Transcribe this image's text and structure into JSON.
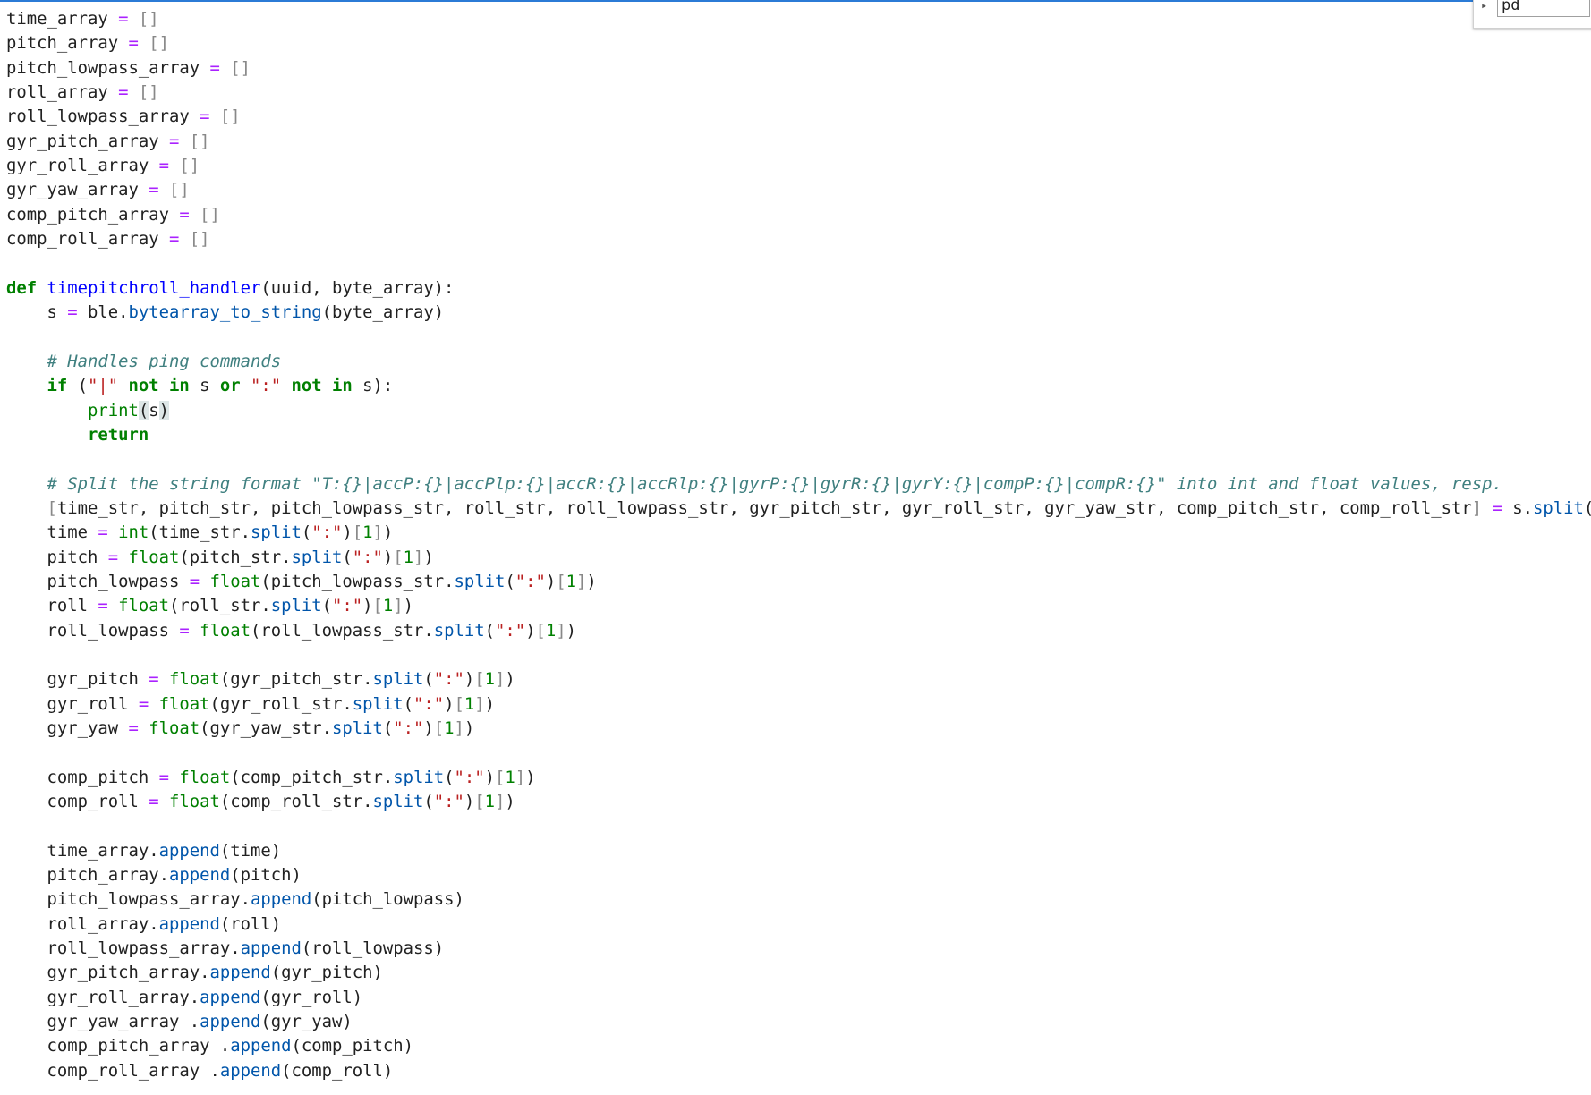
{
  "find_widget": {
    "value": "pd"
  },
  "code": {
    "arrays": [
      "time_array",
      "pitch_array",
      "pitch_lowpass_array",
      "roll_array",
      "roll_lowpass_array",
      "gyr_pitch_array",
      "gyr_roll_array",
      "gyr_yaw_array",
      "comp_pitch_array",
      "comp_roll_array"
    ],
    "func_name": "timepitchroll_handler",
    "params": "(uuid, byte_array):",
    "s_assign": "ble",
    "s_method": "bytearray_to_string",
    "s_arg": "(byte_array)",
    "comment_ping": "# Handles ping commands",
    "comment_split": "# Split the string format \"T:{}|accP:{}|accPlp:{}|accR:{}|accRlp:{}|gyrP:{}|gyrR:{}|gyrY:{}|compP:{}|compR:{}\" into int and float values, resp.",
    "unpack_list": "time_str, pitch_str, pitch_lowpass_str, roll_str, roll_lowpass_str, gyr_pitch_str, gyr_roll_str, gyr_yaw_str, comp_pitch_str, comp_roll_str",
    "parse_groups": [
      [
        {
          "var": "time",
          "cast": "int",
          "src": "time_str"
        },
        {
          "var": "pitch",
          "cast": "float",
          "src": "pitch_str"
        },
        {
          "var": "pitch_lowpass",
          "cast": "float",
          "src": "pitch_lowpass_str"
        },
        {
          "var": "roll",
          "cast": "float",
          "src": "roll_str"
        },
        {
          "var": "roll_lowpass",
          "cast": "float",
          "src": "roll_lowpass_str"
        }
      ],
      [
        {
          "var": "gyr_pitch",
          "cast": "float",
          "src": "gyr_pitch_str"
        },
        {
          "var": "gyr_roll",
          "cast": "float",
          "src": "gyr_roll_str"
        },
        {
          "var": "gyr_yaw",
          "cast": "float",
          "src": "gyr_yaw_str"
        }
      ],
      [
        {
          "var": "comp_pitch",
          "cast": "float",
          "src": "comp_pitch_str"
        },
        {
          "var": "comp_roll",
          "cast": "float",
          "src": "comp_roll_str"
        }
      ]
    ],
    "appends": [
      {
        "target": "time_array",
        "arg": "time"
      },
      {
        "target": "pitch_array",
        "arg": "pitch"
      },
      {
        "target": "pitch_lowpass_array",
        "arg": "pitch_lowpass"
      },
      {
        "target": "roll_array",
        "arg": "roll"
      },
      {
        "target": "roll_lowpass_array",
        "arg": "roll_lowpass"
      },
      {
        "target": "gyr_pitch_array",
        "arg": "gyr_pitch"
      },
      {
        "target": "gyr_roll_array",
        "arg": "gyr_roll"
      },
      {
        "target": "gyr_yaw_array ",
        "arg": "gyr_yaw"
      },
      {
        "target": "comp_pitch_array ",
        "arg": "comp_pitch"
      },
      {
        "target": "comp_roll_array ",
        "arg": "comp_roll"
      }
    ]
  }
}
